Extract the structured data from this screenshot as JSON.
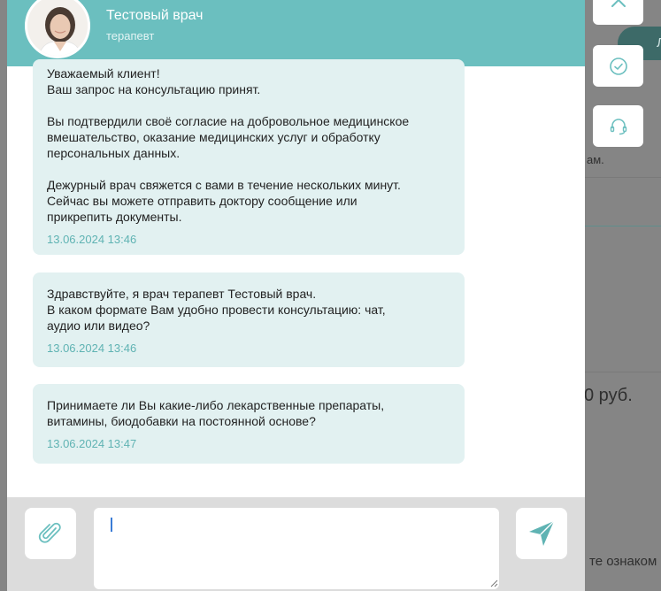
{
  "doctor": {
    "name": "Тестовый врач",
    "role": "терапевт"
  },
  "messages": [
    {
      "lines": [
        "Уважаемый клиент!",
        "Ваш запрос на консультацию принят.",
        "",
        "Вы подтвердили своё согласие на добровольное медицинское",
        "вмешательство, оказание медицинских услуг и обработку",
        "персональных данных.",
        "",
        "Дежурный врач свяжется с вами в течение нескольких минут.",
        "Сейчас вы можете отправить доктору сообщение или",
        "прикрепить документы."
      ],
      "time": "13.06.2024 13:46"
    },
    {
      "lines": [
        "Здравствуйте, я врач терапевт Тестовый врач.",
        "В каком формате Вам удобно провести консультацию: чат,",
        "аудио или видео?"
      ],
      "time": "13.06.2024 13:46"
    },
    {
      "lines": [
        "Принимаете ли Вы какие-либо лекарственные препараты,",
        "витамины, биодобавки на постоянной основе?"
      ],
      "time": "13.06.2024 13:47"
    }
  ],
  "composer": {
    "value": "",
    "placeholder": ""
  },
  "background": {
    "pill_text": "Ли",
    "text_fragment": "ам.",
    "price_fragment": "0 руб.",
    "bottom_fragment": "те ознаком"
  },
  "icons": {
    "attach": "paperclip-icon",
    "send": "send-icon",
    "close": "close-icon",
    "check": "check-circle-icon",
    "support": "headset-icon"
  },
  "colors": {
    "accent": "#6bbfbf",
    "bubble": "#e2f1f1",
    "timestamp": "#5fb3b3",
    "send_icon": "#5fb3b3"
  }
}
